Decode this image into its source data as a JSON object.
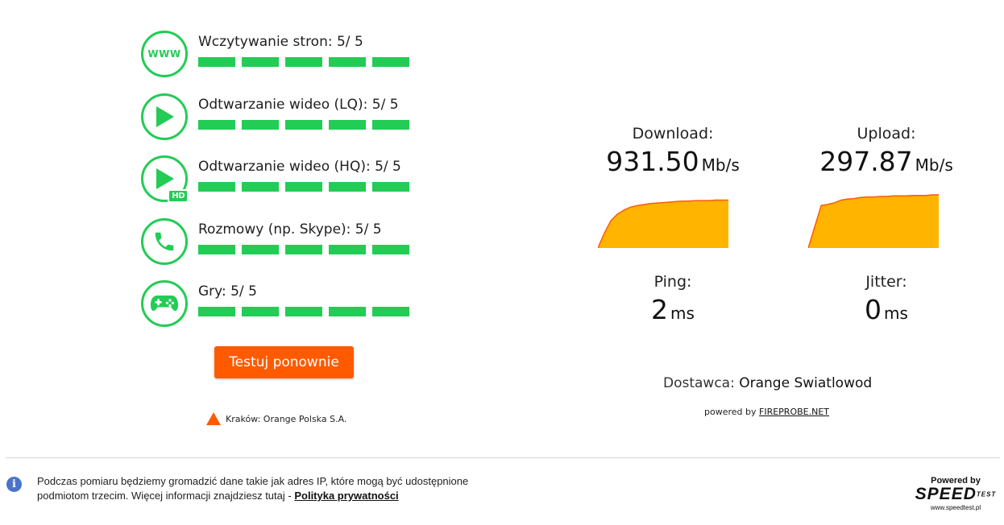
{
  "ratings": [
    {
      "icon": "www-icon",
      "label": "Wczytywanie stron: 5/ 5",
      "score": 5,
      "max": 5
    },
    {
      "icon": "play-icon",
      "label": "Odtwarzanie wideo (LQ): 5/ 5",
      "score": 5,
      "max": 5
    },
    {
      "icon": "play-hd-icon",
      "label": "Odtwarzanie wideo (HQ): 5/ 5",
      "score": 5,
      "max": 5,
      "badge": "HD"
    },
    {
      "icon": "phone-icon",
      "label": "Rozmowy (np. Skype): 5/ 5",
      "score": 5,
      "max": 5
    },
    {
      "icon": "gamepad-icon",
      "label": "Gry: 5/ 5",
      "score": 5,
      "max": 5
    }
  ],
  "icon_texts": {
    "www": "WWW"
  },
  "retest_button": "Testuj ponownie",
  "server": {
    "text": "Kraków: Orange Polska S.A.",
    "marker_color": "#ff5a00"
  },
  "results": {
    "download": {
      "label": "Download:",
      "value": "931.50",
      "unit": "Mb/s",
      "curve": [
        0.0,
        0.3,
        0.55,
        0.68,
        0.76,
        0.82,
        0.85,
        0.87,
        0.89,
        0.9,
        0.91,
        0.92,
        0.93,
        0.94,
        0.94,
        0.95,
        0.95,
        0.95,
        0.96,
        0.96,
        0.96
      ]
    },
    "upload": {
      "label": "Upload:",
      "value": "297.87",
      "unit": "Mb/s",
      "curve": [
        0.0,
        0.4,
        0.8,
        0.82,
        0.85,
        0.9,
        0.92,
        0.93,
        0.95,
        0.96,
        0.96,
        0.97,
        0.97,
        0.98,
        0.98,
        0.98,
        0.99,
        0.99,
        0.99,
        1.0,
        1.0
      ]
    },
    "ping": {
      "label": "Ping:",
      "value": "2",
      "unit": "ms"
    },
    "jitter": {
      "label": "Jitter:",
      "value": "0",
      "unit": "ms"
    }
  },
  "provider": {
    "label": "Dostawca:",
    "name": "Orange Swiatlowod"
  },
  "powered_by": {
    "prefix": "powered by",
    "link": "FIREPROBE.NET"
  },
  "footer": {
    "privacy_text": "Podczas pomiaru będziemy gromadzić dane takie jak adres IP, które mogą być udostępnione podmiotom trzecim. Więcej informacji znajdziesz tutaj -",
    "privacy_link": "Polityka prywatności",
    "info_icon_glyph": "i",
    "logo": {
      "powered": "Powered by",
      "mark": "SPEED",
      "mark_sub": "TEST",
      "url": "www.speedtest.pl"
    }
  },
  "colors": {
    "accent_green": "#22cc55",
    "orange": "#ff5a00",
    "graph_fill": "#ffb400",
    "graph_line": "#ff5a00"
  }
}
